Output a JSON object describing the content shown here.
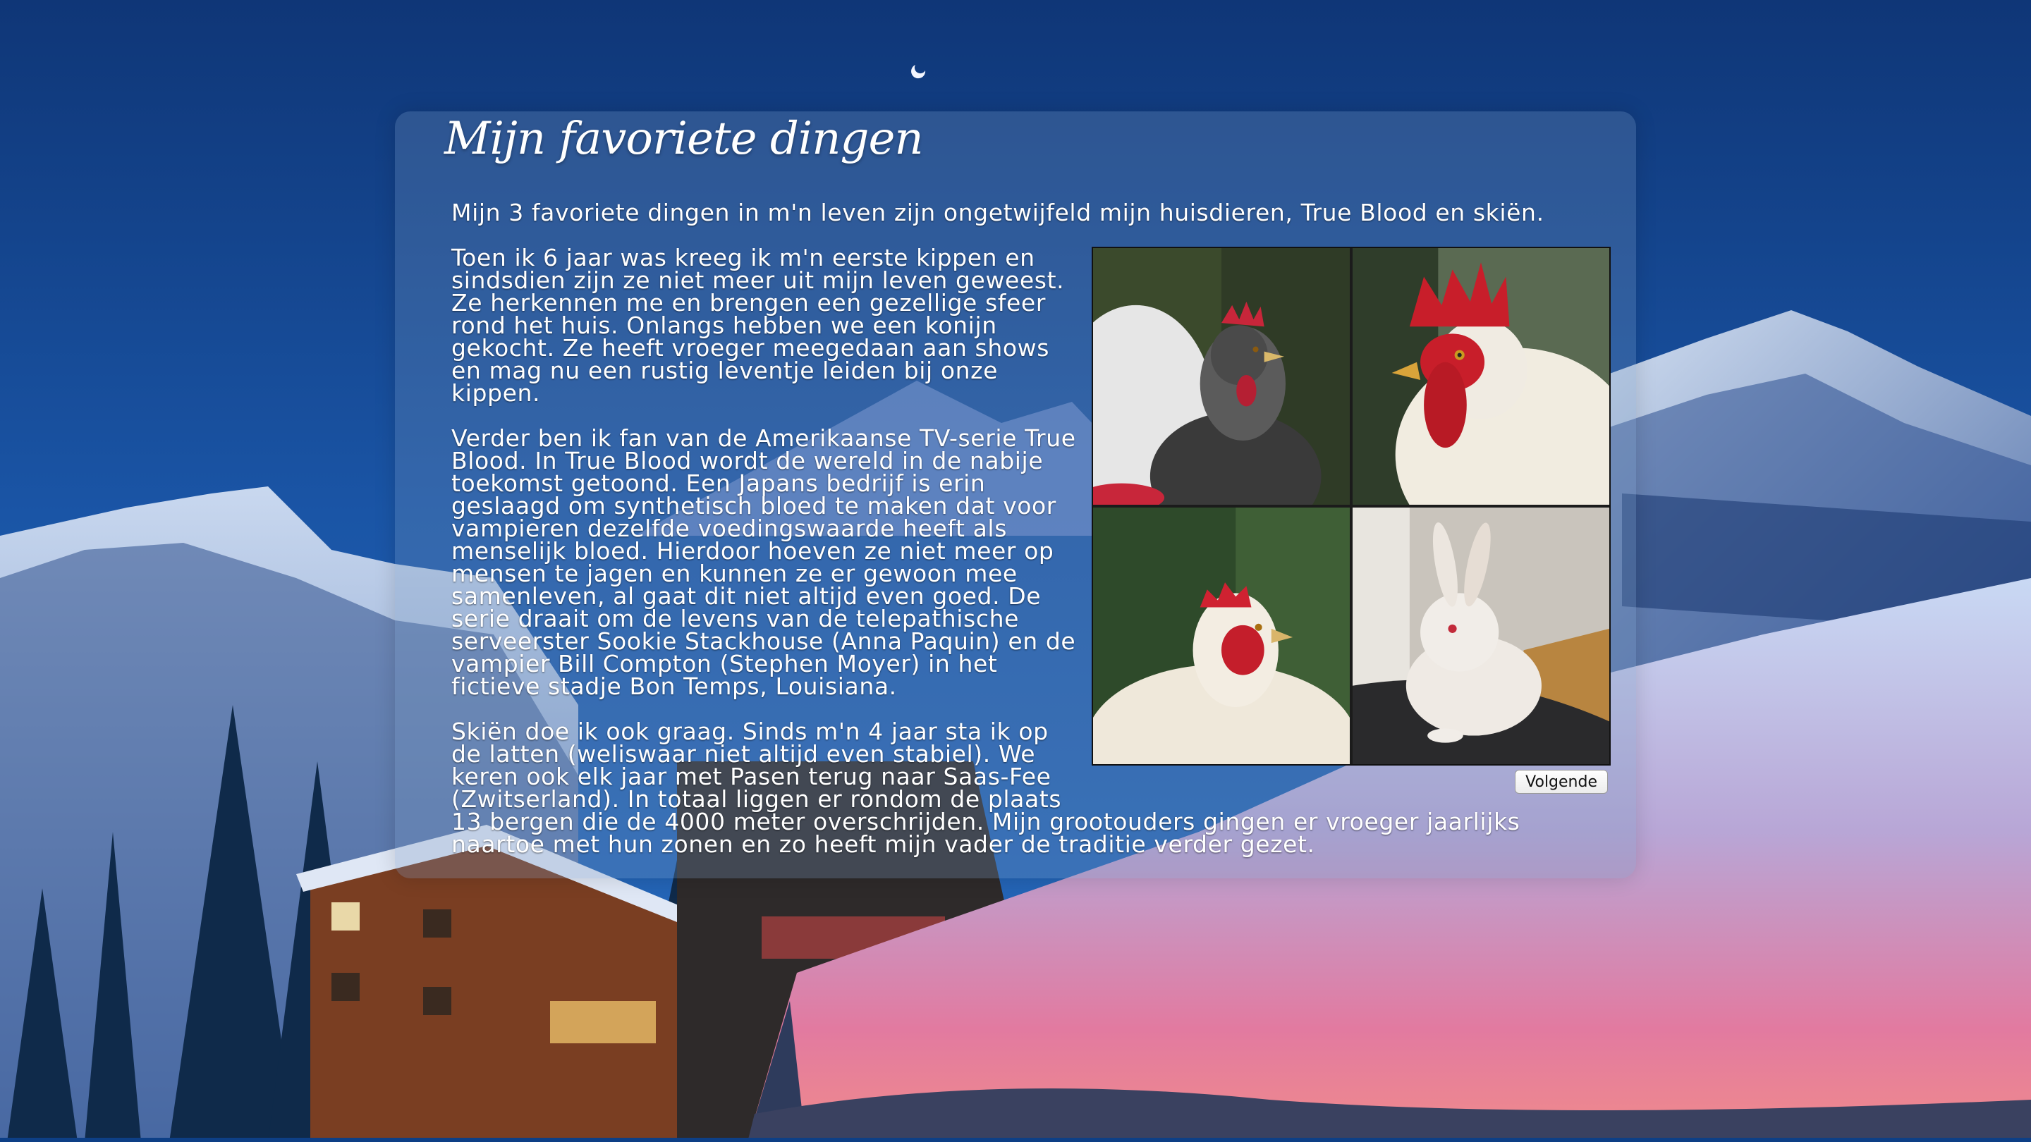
{
  "page": {
    "title": "Mijn favoriete dingen"
  },
  "content": {
    "paragraphs": [
      "Mijn 3 favoriete dingen in m'n leven zijn ongetwijfeld mijn huisdieren, True Blood en skiën.",
      "Toen ik 6 jaar was kreeg ik m'n eerste kippen en sindsdien zijn ze niet meer uit mijn leven geweest. Ze herkennen me en brengen een gezellige sfeer rond het huis. Onlangs hebben we een konijn gekocht. Ze heeft vroeger meegedaan aan shows en mag nu een rustig leventje leiden bij onze kippen.",
      "Verder ben ik fan van de Amerikaanse TV-serie True Blood. In True Blood wordt de wereld in de nabije toekomst getoond. Een Japans bedrijf is erin geslaagd om synthetisch bloed te maken dat voor vampieren dezelfde voedingswaarde heeft als menselijk bloed. Hierdoor hoeven ze niet meer op mensen te jagen en kunnen ze er gewoon mee samenleven, al gaat dit niet altijd even goed. De serie draait om de levens van de telepathische serveerster Sookie Stackhouse (Anna Paquin) en de vampier Bill Compton (Stephen Moyer) in het fictieve stadje Bon Temps, Louisiana.",
      "Skiën doe ik ook graag. Sinds m'n 4 jaar sta ik op de latten (weliswaar niet altijd even stabiel). We keren ook elk jaar met Pasen terug naar Saas-Fee (Zwitserland). In totaal liggen er rondom de plaats 13 bergen die de 4000 meter overschrijden. Mijn grootouders gingen er vroeger jaarlijks naartoe met hun zonen en zo heeft mijn vader de traditie verder gezet."
    ]
  },
  "gallery": {
    "next_label": "Volgende",
    "photos": [
      {
        "icon": "speckled-hen-photo"
      },
      {
        "icon": "white-rooster-photo"
      },
      {
        "icon": "white-hen-photo"
      },
      {
        "icon": "white-rabbit-photo"
      }
    ]
  },
  "colors": {
    "sky_top": "#103a86",
    "sky_bottom": "#1c5db0",
    "panel": "#7896be",
    "text": "#ffffff"
  }
}
